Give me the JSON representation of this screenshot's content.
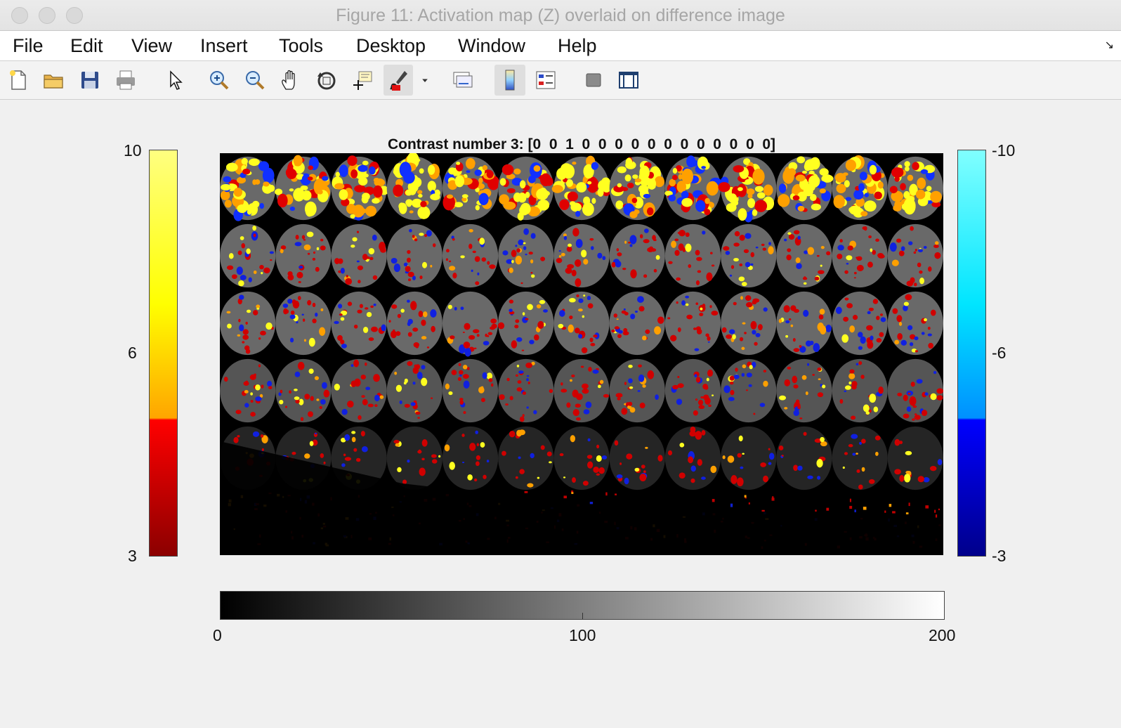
{
  "window": {
    "title": "Figure 11: Activation map (Z) overlaid on difference image"
  },
  "menu": [
    "File",
    "Edit",
    "View",
    "Insert",
    "Tools",
    "Desktop",
    "Window",
    "Help"
  ],
  "toolbar": {
    "icons": [
      "new-figure-icon",
      "open-file-icon",
      "save-icon",
      "print-icon",
      "pointer-icon",
      "zoom-in-icon",
      "zoom-out-icon",
      "pan-icon",
      "rotate-3d-icon",
      "data-cursor-icon",
      "brush-icon",
      "brush-dropdown-icon",
      "link-plot-icon",
      "insert-colorbar-icon",
      "insert-legend-icon",
      "hide-plot-tools-icon",
      "show-plot-tools-icon"
    ]
  },
  "figure": {
    "title": "Contrast number 3: [0  0  1  0  0  0  0  0  0  0  0  0  0  0  0]",
    "montage": {
      "rows": 7,
      "cols": 13
    },
    "colorbar_positive": {
      "ticks": [
        "10",
        "6",
        "3"
      ],
      "colors": [
        "#ffff80",
        "#ffff00",
        "#ffa500",
        "#ff0000",
        "#8b0000"
      ]
    },
    "colorbar_negative": {
      "ticks": [
        "-10",
        "-6",
        "-3"
      ],
      "colors": [
        "#80ffff",
        "#00e5ff",
        "#0090ff",
        "#0000ff",
        "#00008b"
      ]
    },
    "colorbar_gray": {
      "ticks": [
        "0",
        "100",
        "200"
      ],
      "range": [
        0,
        200
      ]
    }
  }
}
